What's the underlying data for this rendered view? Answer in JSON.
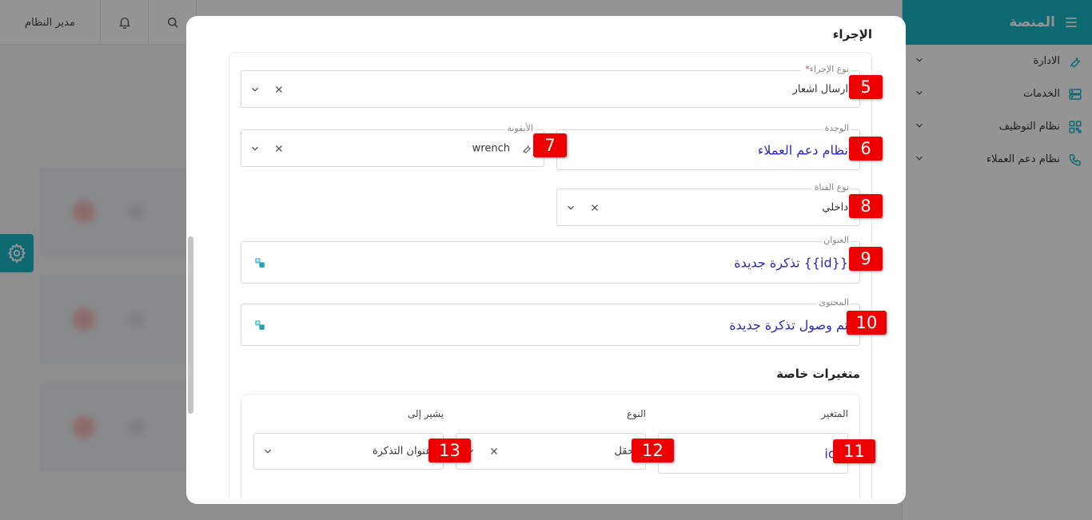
{
  "topbar": {
    "user_label": "مدير النظام"
  },
  "sidebar": {
    "title": "المنصة",
    "items": [
      {
        "label": "الادارة",
        "icon": "wrench-icon"
      },
      {
        "label": "الخدمات",
        "icon": "server-icon"
      },
      {
        "label": "نظام التوظيف",
        "icon": "qr-icon"
      },
      {
        "label": "نظام دعم العملاء",
        "icon": "phone-icon"
      }
    ]
  },
  "modal": {
    "title": "الإجراء",
    "action_type": {
      "label": "نوع الإجراء",
      "required_mark": "*",
      "value": "ارسال اشعار"
    },
    "unit": {
      "label": "الوحدة",
      "value": "نظام دعم العملاء"
    },
    "icon_field": {
      "label": "الأيقونة",
      "value": "wrench"
    },
    "channel_type": {
      "label": "نوع القناة",
      "value": "داخلي"
    },
    "title_field": {
      "label": "العنوان",
      "value": "تذكرة جديدة {{id}}"
    },
    "content_field": {
      "label": "المحتوى",
      "value": "تم وصول تذكرة جديدة"
    },
    "special_vars": {
      "title": "متغيرات خاصة",
      "col_variable": "المتغير",
      "col_type": "النوع",
      "col_points_to": "يشير إلى",
      "row": {
        "variable": "id",
        "type": "حقل",
        "points_to": "عنوان التذكرة"
      }
    }
  },
  "badges": [
    "5",
    "6",
    "7",
    "8",
    "9",
    "10",
    "11",
    "12",
    "13"
  ],
  "colors": {
    "accent": "#19b5c4",
    "badge": "#ee0000",
    "value_blue": "#2b2bb8"
  }
}
